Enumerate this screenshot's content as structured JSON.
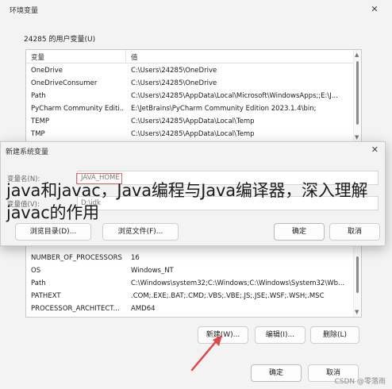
{
  "window": {
    "title": "环境变量",
    "close_glyph": "✕"
  },
  "user_vars": {
    "section_label": "24285 的用户变量(U)",
    "headers": [
      "变量",
      "值"
    ],
    "rows": [
      [
        "OneDrive",
        "C:\\Users\\24285\\OneDrive"
      ],
      [
        "OneDriveConsumer",
        "C:\\Users\\24285\\OneDrive"
      ],
      [
        "Path",
        "C:\\Users\\24285\\AppData\\Local\\Microsoft\\WindowsApps;;E:\\J..."
      ],
      [
        "PyCharm Community Editi...",
        "E:\\JetBrains\\PyCharm Community Edition 2023.1.4\\bin;"
      ],
      [
        "TEMP",
        "C:\\Users\\24285\\AppData\\Local\\Temp"
      ],
      [
        "TMP",
        "C:\\Users\\24285\\AppData\\Local\\Temp"
      ]
    ]
  },
  "dialog": {
    "title": "新建系统变量",
    "close_glyph": "✕",
    "var_name_label": "变量名(N):",
    "var_name_value": "JAVA_HOME",
    "var_value_label": "变量值(V):",
    "var_value_value": "D:\\jdk",
    "browse_dir_label": "浏览目录(D)...",
    "browse_file_label": "浏览文件(F)...",
    "ok_label": "确定",
    "cancel_label": "取消"
  },
  "overlay": {
    "text": "java和javac，Java编程与Java编译器，深入理解javac的作用"
  },
  "sys_vars": {
    "rows": [
      [
        "NUMBER_OF_PROCESSORS",
        "16"
      ],
      [
        "OS",
        "Windows_NT"
      ],
      [
        "Path",
        "C:\\Windows\\system32;C:\\Windows;C:\\Windows\\System32\\Wb..."
      ],
      [
        "PATHEXT",
        ".COM;.EXE;.BAT;.CMD;.VBS;.VBE;.JS;.JSE;.WSF;.WSH;.MSC"
      ],
      [
        "PROCESSOR_ARCHITECT...",
        "AMD64"
      ]
    ],
    "new_label": "新建(W)...",
    "edit_label": "编辑(I)...",
    "delete_label": "删除(L)"
  },
  "footer": {
    "ok_label": "确定",
    "cancel_label": "取消"
  },
  "watermark": "CSDN @零落雨",
  "colors": {
    "annotation_red": "#e04848",
    "highlight_red": "#e26a6a"
  }
}
